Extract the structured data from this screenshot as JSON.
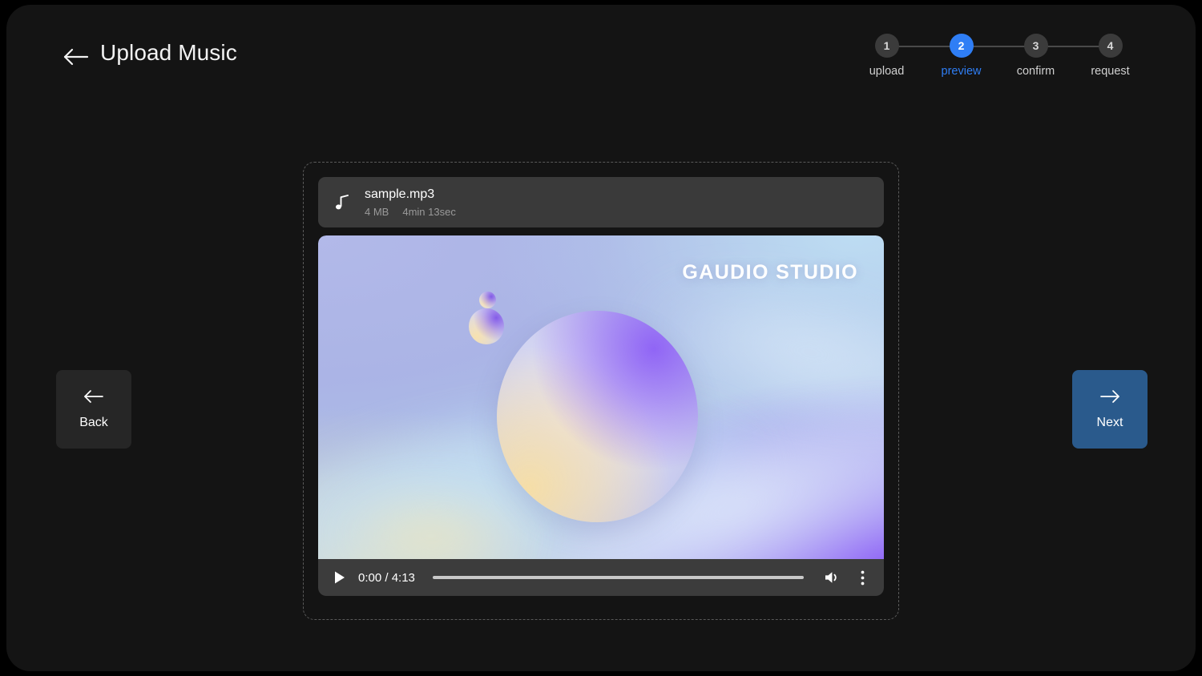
{
  "header": {
    "title": "Upload Music",
    "back_icon": "arrow-left-icon"
  },
  "stepper": {
    "steps": [
      {
        "number": "1",
        "label": "upload",
        "active": false
      },
      {
        "number": "2",
        "label": "preview",
        "active": true
      },
      {
        "number": "3",
        "label": "confirm",
        "active": false
      },
      {
        "number": "4",
        "label": "request",
        "active": false
      }
    ],
    "active_color": "#2f7ef5",
    "inactive_circle_color": "#3b3b3b",
    "line_color": "#4a4a4a"
  },
  "file": {
    "icon": "music-note-icon",
    "name": "sample.mp3",
    "size": "4 MB",
    "duration": "4min 13sec"
  },
  "artwork": {
    "logo_text": "GAUDIO STUDIO",
    "accent_purple": "#8b5cf6",
    "accent_cream": "#f6dea6",
    "accent_blue": "#bedef3",
    "background_lavender": "#b3badf"
  },
  "player": {
    "play_icon": "play-icon",
    "current_time": "0:00",
    "total_time": "4:13",
    "time_display": "0:00 / 4:13",
    "progress_percent": 0,
    "volume_icon": "volume-icon",
    "more_icon": "more-vertical-icon"
  },
  "navigation": {
    "back": {
      "label": "Back",
      "icon": "arrow-left-icon"
    },
    "next": {
      "label": "Next",
      "icon": "arrow-right-icon",
      "color": "#2a5a8c"
    }
  }
}
